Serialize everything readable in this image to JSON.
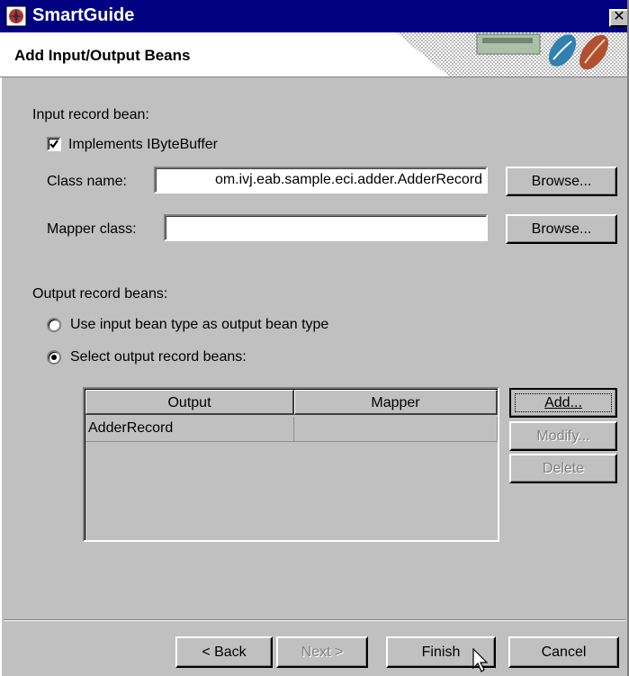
{
  "window": {
    "title": "SmartGuide",
    "close_symbol": "✕"
  },
  "header": {
    "title": "Add Input/Output Beans"
  },
  "input_section": {
    "label": "Input record bean:",
    "implements_checkbox": {
      "label": "Implements IByteBuffer",
      "checked": true
    },
    "class_name": {
      "label": "Class name:",
      "value": "om.ivj.eab.sample.eci.adder.AdderRecord",
      "browse": "Browse..."
    },
    "mapper_class": {
      "label": "Mapper class:",
      "value": "",
      "browse": "Browse..."
    }
  },
  "output_section": {
    "label": "Output record beans:",
    "option_use_input": "Use input bean type as output bean type",
    "option_select": "Select output record beans:",
    "selected_option": "select",
    "table": {
      "columns": [
        "Output",
        "Mapper"
      ],
      "rows": [
        [
          "AdderRecord",
          ""
        ]
      ]
    },
    "buttons": {
      "add": "Add...",
      "modify": "Modify...",
      "delete": "Delete"
    }
  },
  "footer": {
    "back": "< Back",
    "next": "Next >",
    "finish": "Finish",
    "cancel": "Cancel"
  },
  "colors": {
    "titlebar": "#000080",
    "dialog": "#c0c0c0"
  }
}
